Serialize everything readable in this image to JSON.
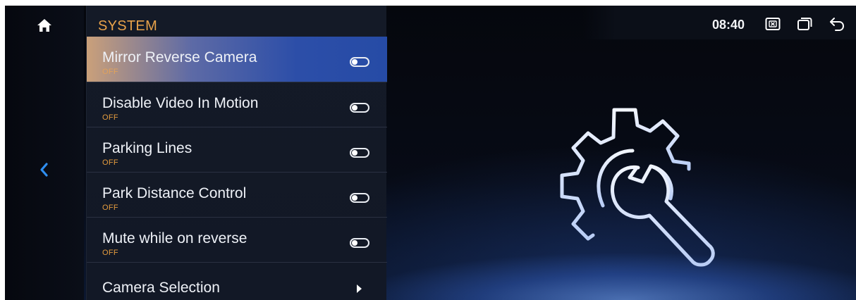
{
  "status_bar": {
    "time": "08:40"
  },
  "panel": {
    "title": "SYSTEM",
    "items": [
      {
        "label": "Mirror Reverse Camera",
        "value": "OFF",
        "control": "toggle",
        "selected": true
      },
      {
        "label": "Disable Video In Motion",
        "value": "OFF",
        "control": "toggle",
        "selected": false
      },
      {
        "label": "Parking Lines",
        "value": "OFF",
        "control": "toggle",
        "selected": false
      },
      {
        "label": "Park Distance Control",
        "value": "OFF",
        "control": "toggle",
        "selected": false
      },
      {
        "label": "Mute while on reverse",
        "value": "OFF",
        "control": "toggle",
        "selected": false
      },
      {
        "label": "Camera Selection",
        "control": "submenu",
        "selected": false
      }
    ]
  },
  "icons": {
    "home": "home-icon",
    "back": "chevron-left-icon",
    "close_window": "close-window-icon",
    "recent_apps": "recent-apps-icon",
    "return": "return-icon",
    "settings_graphic": "settings-gear-wrench-icon"
  },
  "colors": {
    "accent": "#e8a24a",
    "highlight": "#2c4ea8",
    "background": "#070b16"
  }
}
